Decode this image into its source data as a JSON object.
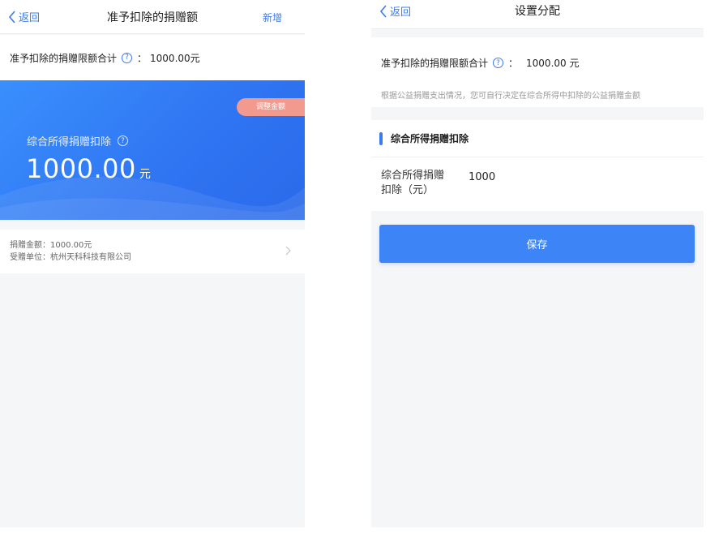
{
  "left": {
    "nav": {
      "back": "返回",
      "title": "准予扣除的捐赠额",
      "action": "新增"
    },
    "limit": {
      "label": "准予扣除的捐赠限额合计",
      "sep": "：",
      "value": "1000.00元"
    },
    "hero": {
      "adjust_label": "调整金额",
      "label": "综合所得捐赠扣除",
      "amount": "1000.00",
      "unit": "元"
    },
    "donation": {
      "amount_line": "捐赠金额：1000.00元",
      "recipient_line": "受赠单位：杭州天科科技有限公司"
    }
  },
  "right": {
    "nav": {
      "back": "返回",
      "title": "设置分配"
    },
    "limit": {
      "label": "准予扣除的捐赠限额合计",
      "sep": "：",
      "value": "1000.00 元"
    },
    "hint": "根据公益捐赠支出情况，您可自行决定在综合所得中扣除的公益捐赠金额",
    "section_title": "综合所得捐赠扣除",
    "field": {
      "label": "综合所得捐赠扣除（元）",
      "value": "1000"
    },
    "save_label": "保存"
  },
  "icons": {
    "back": "chevron-left-icon",
    "help": "question-circle-icon",
    "more": "chevron-right-icon"
  },
  "colors": {
    "accent": "#3a7bf2",
    "hero_gradient": "#2f74f2",
    "adjust_badge": "#f39a8f",
    "save_button": "#3d85f6"
  }
}
